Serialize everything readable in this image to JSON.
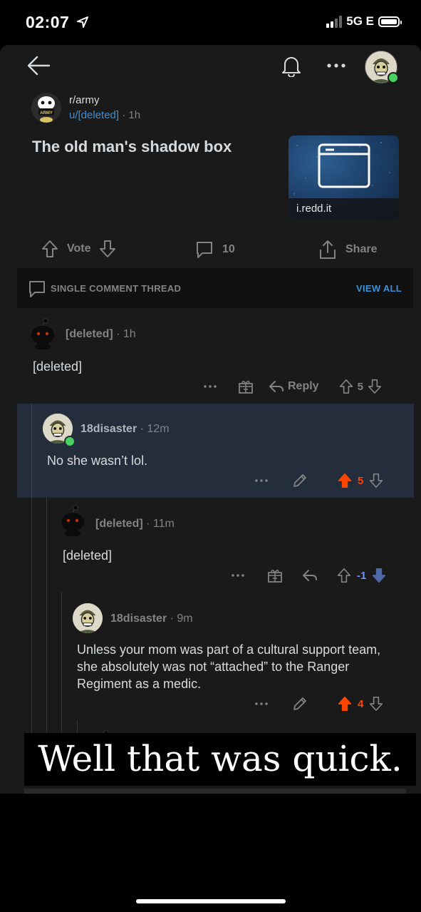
{
  "status_bar": {
    "time": "02:07",
    "network": "5G E"
  },
  "header": {
    "back_icon": "back-arrow-icon",
    "bell_icon": "bell-icon",
    "more_icon": "more-icon"
  },
  "post": {
    "subreddit": "r/army",
    "author": "u/[deleted]",
    "age": "· 1h",
    "title": "The old man's shadow box",
    "thumbnail_domain": "i.redd.it",
    "vote_label": "Vote",
    "comment_count": "10",
    "share_label": "Share"
  },
  "thread_bar": {
    "label": "SINGLE COMMENT THREAD",
    "view_all": "VIEW ALL"
  },
  "comments": [
    {
      "author": "[deleted]",
      "age": "· 1h",
      "body": "[deleted]",
      "score": "5",
      "reply_label": "Reply"
    },
    {
      "author": "18disaster",
      "age": "· 12m",
      "body": "No she wasn’t lol.",
      "score": "5"
    },
    {
      "author": "[deleted]",
      "age": "· 11m",
      "body": "[deleted]",
      "score": "-1"
    },
    {
      "author": "18disaster",
      "age": "· 9m",
      "body": "Unless your mom was part of a cultural support team, she absolutely was not “attached” to the Ranger Regiment as a medic.",
      "score": "4"
    }
  ],
  "caption": "Well that was quick.",
  "colors": {
    "accent_blue": "#3d8fd6",
    "upvote_orange": "#ff4500",
    "downvote_blue": "#7193ff",
    "online_green": "#46d160"
  }
}
